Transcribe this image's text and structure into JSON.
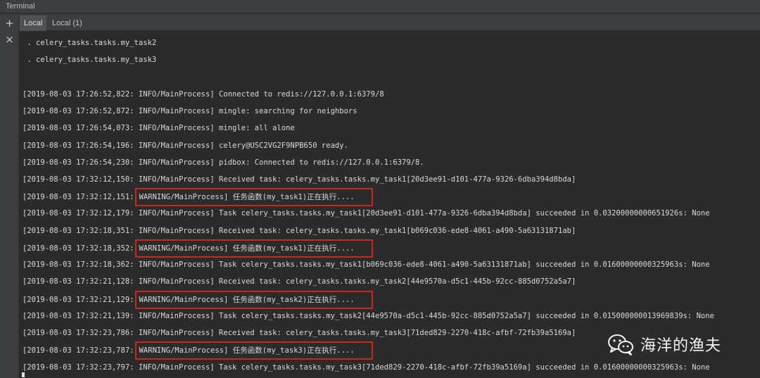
{
  "window": {
    "title": "Terminal"
  },
  "left_toolbar": {
    "add_icon_glyph": "+",
    "close_icon_glyph": "×"
  },
  "tabs": [
    {
      "label": "Local",
      "active": true
    },
    {
      "label": "Local (1)",
      "active": false
    }
  ],
  "console": {
    "lines": [
      {
        "text": " . celery_tasks.tasks.my_task2"
      },
      {
        "text": " . celery_tasks.tasks.my_task3"
      },
      {
        "text": ""
      },
      {
        "text": "[2019-08-03 17:26:52,822: INFO/MainProcess] Connected to redis://127.0.0.1:6379/8"
      },
      {
        "text": "[2019-08-03 17:26:52,872: INFO/MainProcess] mingle: searching for neighbors"
      },
      {
        "text": "[2019-08-03 17:26:54,073: INFO/MainProcess] mingle: all alone"
      },
      {
        "text": "[2019-08-03 17:26:54,196: INFO/MainProcess] celery@USC2VG2F9NPB650 ready."
      },
      {
        "text": "[2019-08-03 17:26:54,230: INFO/MainProcess] pidbox: Connected to redis://127.0.0.1:6379/8."
      },
      {
        "text": "[2019-08-03 17:32:12,150: INFO/MainProcess] Received task: celery_tasks.tasks.my_task1[20d3ee91-d101-477a-9326-6dba394d8bda]"
      },
      {
        "prefix": "[2019-08-03 17:32:12,151:",
        "highlight": "WARNING/MainProcess] 任务函数(my_task1)正在执行...."
      },
      {
        "text": "[2019-08-03 17:32:12,179: INFO/MainProcess] Task celery_tasks.tasks.my_task1[20d3ee91-d101-477a-9326-6dba394d8bda] succeeded in 0.03200000000651926s: None"
      },
      {
        "text": "[2019-08-03 17:32:18,351: INFO/MainProcess] Received task: celery_tasks.tasks.my_task1[b069c036-ede8-4061-a490-5a63131871ab]"
      },
      {
        "prefix": "[2019-08-03 17:32:18,352:",
        "highlight": "WARNING/MainProcess] 任务函数(my_task1)正在执行...."
      },
      {
        "text": "[2019-08-03 17:32:18,362: INFO/MainProcess] Task celery_tasks.tasks.my_task1[b069c036-ede8-4061-a490-5a63131871ab] succeeded in 0.01600000000325963s: None"
      },
      {
        "text": "[2019-08-03 17:32:21,128: INFO/MainProcess] Received task: celery_tasks.tasks.my_task2[44e9570a-d5c1-445b-92cc-885d0752a5a7]"
      },
      {
        "prefix": "[2019-08-03 17:32:21,129:",
        "highlight": "WARNING/MainProcess] 任务函数(my_task2)正在执行...."
      },
      {
        "text": "[2019-08-03 17:32:21,139: INFO/MainProcess] Task celery_tasks.tasks.my_task2[44e9570a-d5c1-445b-92cc-885d0752a5a7] succeeded in 0.015000000013969839s: None"
      },
      {
        "text": "[2019-08-03 17:32:23,786: INFO/MainProcess] Received task: celery_tasks.tasks.my_task3[71ded829-2270-418c-afbf-72fb39a5169a]"
      },
      {
        "prefix": "[2019-08-03 17:32:23,787:",
        "highlight": "WARNING/MainProcess] 任务函数(my_task3)正在执行...."
      },
      {
        "text": "[2019-08-03 17:32:23,797: INFO/MainProcess] Task celery_tasks.tasks.my_task3[71ded829-2270-418c-afbf-72fb39a5169a] succeeded in 0.01600000000325963s: None"
      }
    ]
  },
  "watermark": {
    "icon": "wechat-icon",
    "text": "海洋的渔夫"
  },
  "colors": {
    "background": "#2b2b2b",
    "text": "#d9d9d9",
    "highlight_border": "#c8281e",
    "chrome": "#3c3f41"
  }
}
